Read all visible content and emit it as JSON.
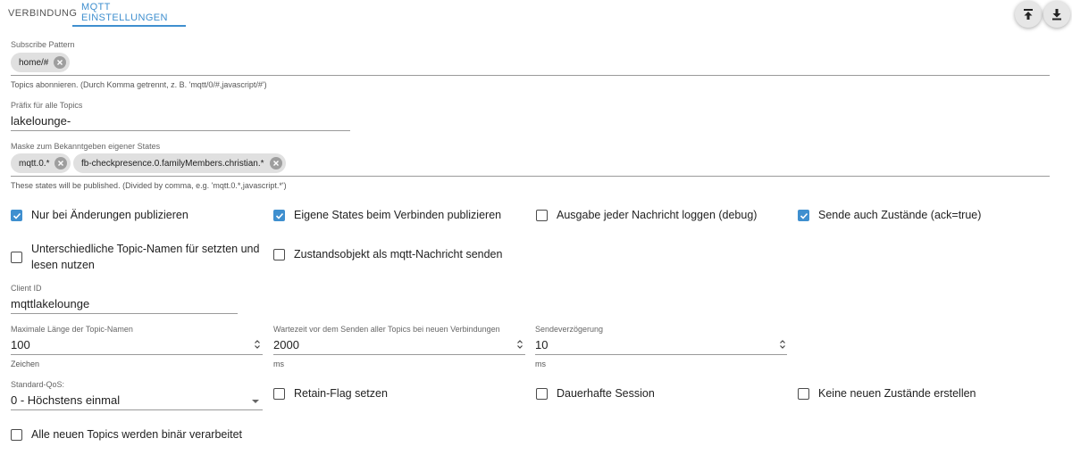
{
  "tabs": [
    {
      "label": "VERBINDUNG"
    },
    {
      "label": "MQTT EINSTELLUNGEN"
    }
  ],
  "actions": {
    "upload_icon": "upload-to-top-icon",
    "download_icon": "download-icon"
  },
  "subscribe": {
    "label": "Subscribe Pattern",
    "chips": [
      "home/#"
    ],
    "helper": "Topics abonnieren. (Durch Komma getrennt, z. B. 'mqtt/0/#,javascript/#')"
  },
  "prefix": {
    "label": "Präfix für alle Topics",
    "value": "lakelounge-"
  },
  "mask": {
    "label": "Maske zum Bekanntgeben eigener States",
    "chips": [
      "mqtt.0.*",
      "fb-checkpresence.0.familyMembers.christian.*"
    ],
    "helper": "These states will be published. (Divided by comma, e.g. 'mqtt.0.*,javascript.*')"
  },
  "checkboxes": {
    "only_changes": {
      "label": "Nur bei Änderungen publizieren",
      "checked": true
    },
    "own_states_on_connect": {
      "label": "Eigene States beim Verbinden publizieren",
      "checked": true
    },
    "log_every_message": {
      "label": "Ausgabe jeder Nachricht loggen (debug)",
      "checked": false
    },
    "send_ack_true": {
      "label": "Sende auch Zustände (ack=true)",
      "checked": true
    },
    "different_topic_names_line1": {
      "label": "Unterschiedliche Topic-Namen für setzten und",
      "checked": false
    },
    "different_topic_names_line2": "lesen nutzen",
    "state_object_as_message": {
      "label": "Zustandsobjekt als mqtt-Nachricht senden",
      "checked": false
    },
    "retain_flag": {
      "label": "Retain-Flag setzen",
      "checked": false
    },
    "persistent_session": {
      "label": "Dauerhafte Session",
      "checked": false
    },
    "no_new_states": {
      "label": "Keine neuen Zustände erstellen",
      "checked": false
    },
    "all_binary": {
      "label": "Alle neuen Topics werden binär verarbeitet",
      "checked": false
    }
  },
  "client_id": {
    "label": "Client ID",
    "value": "mqttlakelounge"
  },
  "max_topic_length": {
    "label": "Maximale Länge der Topic-Namen",
    "value": "100",
    "unit": "Zeichen"
  },
  "wait_before_send": {
    "label": "Wartezeit vor dem Senden aller Topics bei neuen Verbindungen",
    "value": "2000",
    "unit": "ms"
  },
  "send_delay": {
    "label": "Sendeverzögerung",
    "value": "10",
    "unit": "ms"
  },
  "qos": {
    "label": "Standard-QoS:",
    "value": "0 - Höchstens einmal"
  },
  "colors": {
    "accent": "#3f8fcf",
    "chip": "#e0e0e0"
  }
}
